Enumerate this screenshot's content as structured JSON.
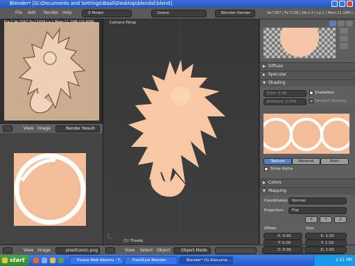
{
  "window": {
    "title": "Blender* [G:\\Documents and Settings\\Basil\\Desktop\\blendsf.blend]"
  },
  "menu": {
    "file": "File",
    "add": "Add",
    "render": "Render",
    "help": "Help"
  },
  "header": {
    "layout": "Z-Model",
    "scene": "Scene",
    "engine": "Blender Render",
    "stats": "Ve:7267 | Fa:7138 | Ob:1-3 | La:1 | Mem:11.16M (29"
  },
  "image_editor": {
    "stats": "Fra:1  Ve:7267 Fa:13259 La:1 Mem:11.29M (29.45M)",
    "view": "View",
    "image": "Image",
    "slot": "Render Result"
  },
  "texture_editor": {
    "view": "View",
    "image": "Image",
    "file": "pixelComic.png"
  },
  "viewport": {
    "camera_label": "Camera Persp",
    "object_label": "(1) Theobj",
    "view": "View",
    "select": "Select",
    "object": "Object",
    "mode": "Object Mode"
  },
  "properties": {
    "diffuse": "Diffuse",
    "specular": "Specular",
    "shading": "Shading",
    "emit": "Emit: 0.00",
    "shadeless": "Shadeless",
    "ambient": "Ambient: 1.000",
    "tangent": "Tangent Shading",
    "tabs": [
      "Texture",
      "Material",
      "Both"
    ],
    "show_alpha": "Show Alpha",
    "colors": "Colors",
    "mapping": "Mapping",
    "coordinates_label": "Coordinates:",
    "coordinates": "Normal",
    "projection_label": "Projection:",
    "projection": "Flat",
    "axes": [
      "X",
      "Y",
      "Z"
    ],
    "offset_label": "Offset:",
    "size_label": "Size:",
    "offsets": [
      "X: 0.00",
      "Y: 0.00",
      "Z: 0.00"
    ],
    "sizes": [
      "X: 1.00",
      "Y: 1.00",
      "Z: 1.00"
    ]
  },
  "taskbar": {
    "start": "start",
    "tasks": [
      "Picasa Web Albums - F...",
      "FreeStyle Blender",
      "Blender* [G:\\Docume..."
    ],
    "clock": "2:21 PM"
  },
  "colors": {
    "skin": "#f6c09c",
    "accent": "#5680c2",
    "panel": "#5f5f5f"
  }
}
